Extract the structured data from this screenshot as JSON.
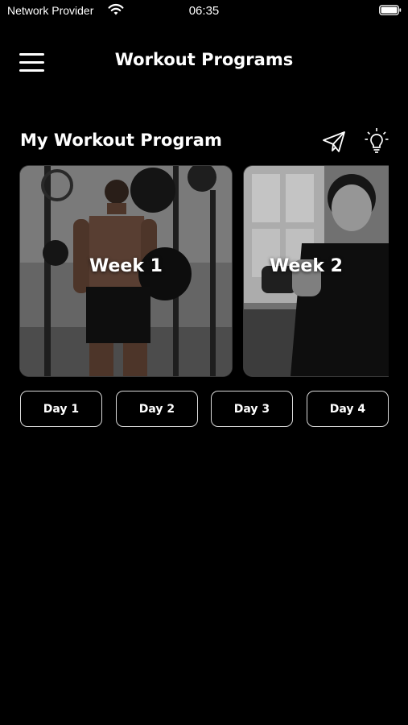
{
  "status_bar": {
    "carrier": "Network Provider",
    "time": "06:35"
  },
  "header": {
    "title": "Workout Programs",
    "menu_icon": "hamburger-menu-icon"
  },
  "program": {
    "title": "My Workout Program",
    "actions": [
      {
        "icon": "paper-plane-icon"
      },
      {
        "icon": "lightbulb-icon"
      }
    ],
    "weeks": [
      {
        "label": "Week 1"
      },
      {
        "label": "Week 2"
      }
    ],
    "days": [
      {
        "label": "Day 1"
      },
      {
        "label": "Day 2"
      },
      {
        "label": "Day 3"
      },
      {
        "label": "Day 4"
      }
    ]
  },
  "colors": {
    "background": "#000000",
    "text": "#ffffff",
    "button_border": "#d9d9d9"
  }
}
